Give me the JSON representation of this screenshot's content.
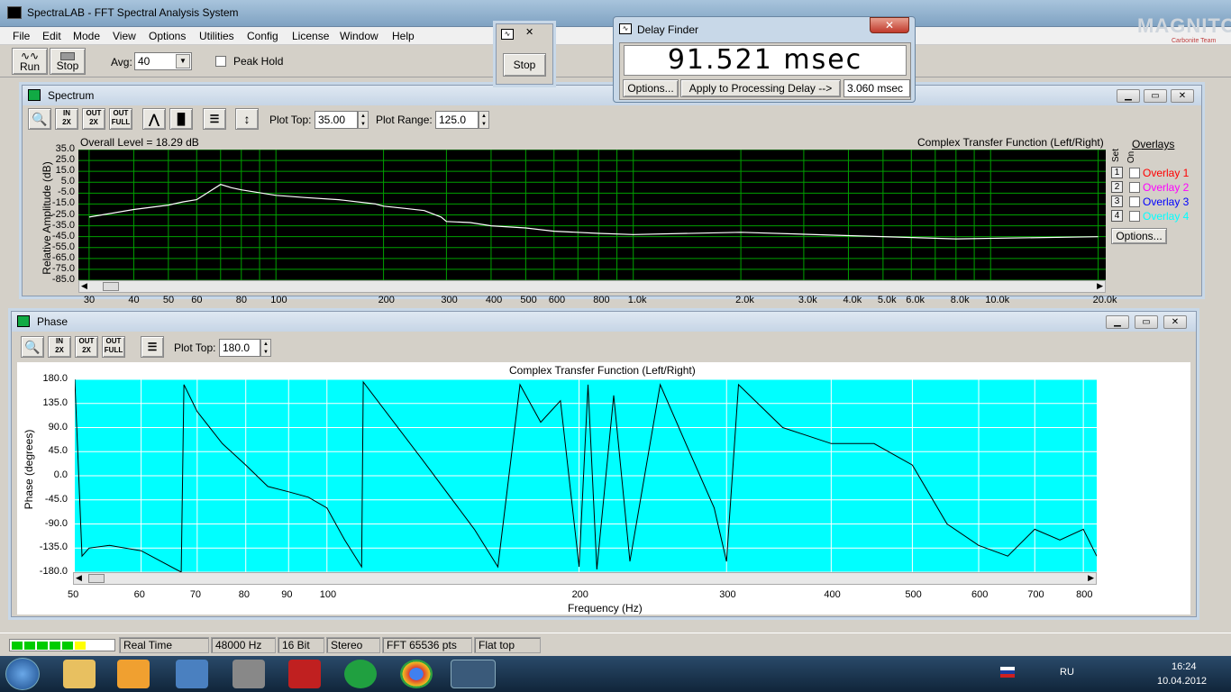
{
  "window": {
    "title": "SpectraLAB - FFT Spectral Analysis System"
  },
  "menu": [
    "File",
    "Edit",
    "Mode",
    "View",
    "Options",
    "Utilities",
    "Config",
    "License",
    "Window",
    "Help"
  ],
  "toolbar": {
    "run_label": "Run",
    "stop_label": "Stop",
    "avg_label": "Avg:",
    "avg_value": "40",
    "peak_hold_label": "Peak Hold"
  },
  "stop_window": {
    "stop_label": "Stop"
  },
  "delay_finder": {
    "title": "Delay Finder",
    "readout": "91.521 msec",
    "options_label": "Options...",
    "apply_label": "Apply to Processing Delay -->",
    "delay_value": "3.060 msec"
  },
  "spectrum": {
    "title": "Spectrum",
    "plot_top_label": "Plot Top:",
    "plot_top_value": "35.00",
    "plot_range_label": "Plot Range:",
    "plot_range_value": "125.0",
    "overall_level": "Overall Level = 18.29 dB",
    "plot_title": "Complex Transfer Function (Left/Right)",
    "ylabel": "Relative Amplitude (dB)",
    "yticks": [
      "35.0",
      "25.0",
      "15.0",
      "5.0",
      "-5.0",
      "-15.0",
      "-25.0",
      "-35.0",
      "-45.0",
      "-55.0",
      "-65.0",
      "-75.0",
      "-85.0"
    ],
    "xticks": [
      "30",
      "40",
      "50",
      "60",
      "80",
      "100",
      "200",
      "300",
      "400",
      "500",
      "600",
      "800",
      "1.0k",
      "2.0k",
      "3.0k",
      "4.0k",
      "5.0k",
      "6.0k",
      "8.0k",
      "10.0k",
      "20.0k"
    ],
    "overlays_title": "Overlays",
    "set_label": "Set",
    "on_label": "On",
    "overlays": [
      {
        "num": "1",
        "label": "Overlay 1",
        "color": "#ff0000"
      },
      {
        "num": "2",
        "label": "Overlay 2",
        "color": "#ff00ff"
      },
      {
        "num": "3",
        "label": "Overlay 3",
        "color": "#0000ff"
      },
      {
        "num": "4",
        "label": "Overlay 4",
        "color": "#00ffff"
      }
    ],
    "options_label": "Options..."
  },
  "phase": {
    "title": "Phase",
    "plot_top_label": "Plot Top:",
    "plot_top_value": "180.0",
    "plot_title": "Complex Transfer Function (Left/Right)",
    "ylabel": "Phase (degrees)",
    "xlabel": "Frequency (Hz)",
    "yticks": [
      "180.0",
      "135.0",
      "90.0",
      "45.0",
      "0.0",
      "-45.0",
      "-90.0",
      "-135.0",
      "-180.0"
    ],
    "xticks": [
      "50",
      "60",
      "70",
      "80",
      "90",
      "100",
      "200",
      "300",
      "400",
      "500",
      "600",
      "700",
      "800"
    ]
  },
  "status": {
    "mode": "Real Time",
    "rate": "48000 Hz",
    "bits": "16 Bit",
    "channels": "Stereo",
    "fft": "FFT 65536 pts",
    "window": "Flat top"
  },
  "taskbar": {
    "lang": "RU",
    "time": "16:24",
    "date": "10.04.2012"
  },
  "watermark": {
    "text": "MAGNITOLA",
    "sub": "Carbonite Team"
  },
  "chart_data": [
    {
      "type": "line",
      "title": "Complex Transfer Function (Left/Right)",
      "ylabel": "Relative Amplitude (dB)",
      "xscale": "log",
      "xlim": [
        28,
        21000
      ],
      "ylim": [
        -85,
        35
      ],
      "x": [
        30,
        40,
        50,
        55,
        60,
        70,
        75,
        80,
        100,
        120,
        150,
        190,
        200,
        230,
        260,
        290,
        300,
        350,
        400,
        500,
        600,
        800,
        1000,
        2000,
        4000,
        8000,
        20000
      ],
      "series": [
        {
          "values": [
            -27,
            -20,
            -16,
            -13,
            -11,
            3,
            0,
            -2,
            -7,
            -9,
            -11,
            -15,
            -17,
            -19,
            -21,
            -27,
            -31,
            -32,
            -35,
            -37,
            -40,
            -42,
            -43,
            -41,
            -44,
            -47,
            -45
          ]
        }
      ],
      "grid": true
    },
    {
      "type": "line",
      "title": "Complex Transfer Function (Left/Right)",
      "xlabel": "Frequency (Hz)",
      "ylabel": "Phase (degrees)",
      "xscale": "log",
      "xlim": [
        50,
        830
      ],
      "ylim": [
        -180,
        180
      ],
      "x": [
        50,
        51,
        52,
        55,
        60,
        67,
        67.5,
        70,
        75,
        80,
        85,
        90,
        95,
        100,
        105,
        110,
        110.5,
        130,
        150,
        160,
        170,
        180,
        190,
        200,
        205,
        210,
        220,
        230,
        250,
        270,
        290,
        300,
        310,
        350,
        400,
        450,
        500,
        550,
        600,
        650,
        700,
        750,
        800,
        830
      ],
      "series": [
        {
          "values": [
            180,
            -150,
            -135,
            -130,
            -140,
            -180,
            170,
            120,
            60,
            20,
            -20,
            -30,
            -40,
            -60,
            -120,
            -170,
            175,
            30,
            -100,
            -170,
            170,
            100,
            140,
            -170,
            170,
            -175,
            150,
            -160,
            170,
            50,
            -60,
            -160,
            170,
            90,
            60,
            60,
            20,
            -90,
            -130,
            -150,
            -100,
            -120,
            -100,
            -150
          ]
        }
      ],
      "grid": true
    }
  ]
}
